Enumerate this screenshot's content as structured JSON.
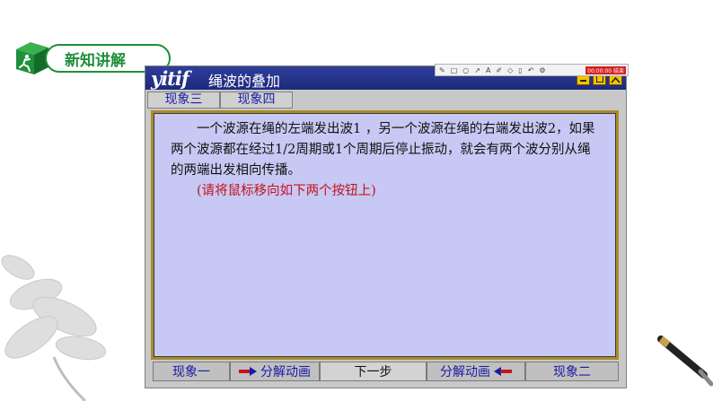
{
  "badge": {
    "label": "新知讲解"
  },
  "window": {
    "logo": "yitif",
    "title": "绳波的叠加",
    "pen_toolbar": {
      "timer": "00:00:00 结束"
    }
  },
  "tabs": [
    {
      "label": "现象三"
    },
    {
      "label": "现象四"
    }
  ],
  "content": {
    "paragraph": "一个波源在绳的左端发出波1 ，另一个波源在绳的右端发出波2，如果两个波源都在经过1/2周期或1个周期后停止振动，就会有两个波分别从绳的两端出发相向传播。",
    "hint": "(请将鼠标移向如下两个按钮上)"
  },
  "bottom_bar": {
    "left_phenomenon": "现象一",
    "left_animation": "分解动画",
    "next_step": "下一步",
    "right_animation": "分解动画",
    "right_phenomenon": "现象二"
  },
  "colors": {
    "badge_green": "#1f8f3a",
    "titlebar_blue": "#1c2a7c",
    "content_bg": "#c8c8f4",
    "frame_gold": "#a98b2c",
    "link_blue": "#1a1aa8",
    "hint_red": "#c2141c"
  }
}
